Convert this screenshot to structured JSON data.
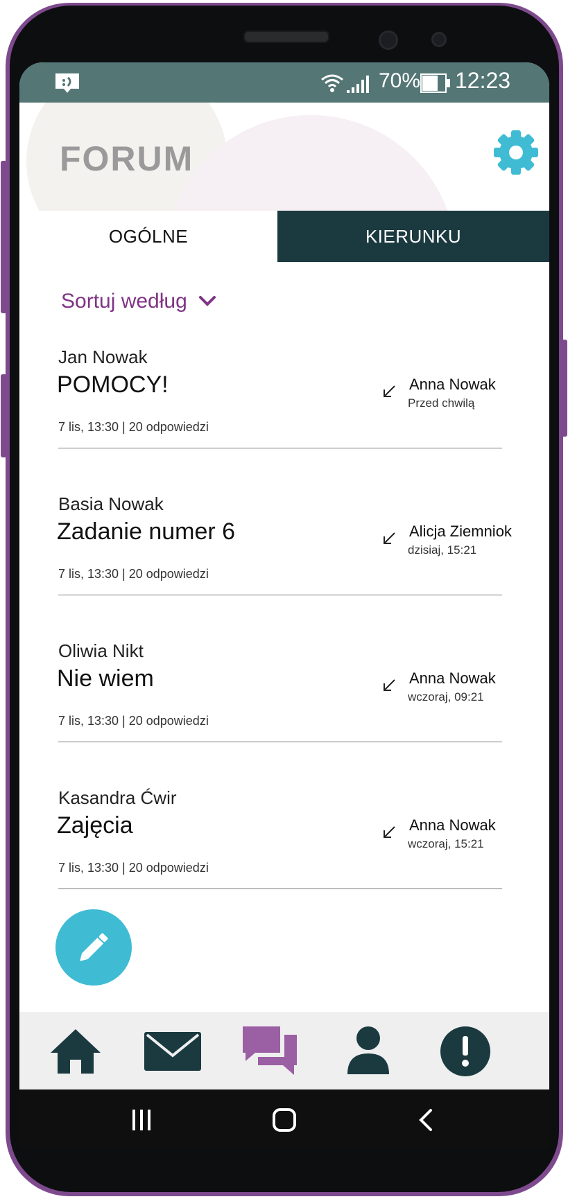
{
  "status_bar": {
    "battery_percent": "70%",
    "time": "12:23"
  },
  "header": {
    "title": "FORUM",
    "settings_icon": "gear-icon"
  },
  "tabs": [
    {
      "label": "OGÓLNE",
      "active": true
    },
    {
      "label": "KIERUNKU",
      "active": false
    }
  ],
  "sort": {
    "label": "Sortuj według",
    "icon": "chevron-down-icon"
  },
  "posts": [
    {
      "author": "Jan Nowak",
      "title": "POMOCY!",
      "meta": "7 lis, 13:30 | 20 odpowiedzi",
      "last_reply_name": "Anna Nowak",
      "last_reply_time": "Przed chwilą"
    },
    {
      "author": "Basia Nowak",
      "title": "Zadanie numer 6",
      "meta": "7 lis, 13:30 | 20 odpowiedzi",
      "last_reply_name": "Alicja Ziemniok",
      "last_reply_time": "dzisiaj, 15:21"
    },
    {
      "author": "Oliwia Nikt",
      "title": "Nie wiem",
      "meta": "7 lis, 13:30 | 20 odpowiedzi",
      "last_reply_name": "Anna Nowak",
      "last_reply_time": "wczoraj, 09:21"
    },
    {
      "author": "Kasandra Ćwir",
      "title": "Zajęcia",
      "meta": "7 lis, 13:30 | 20 odpowiedzi",
      "last_reply_name": "Anna Nowak",
      "last_reply_time": "wczoraj, 15:21"
    }
  ],
  "fab": {
    "icon": "pencil-icon"
  },
  "bottom_nav": [
    {
      "icon": "home-icon",
      "active": false
    },
    {
      "icon": "mail-icon",
      "active": false
    },
    {
      "icon": "forum-icon",
      "active": true
    },
    {
      "icon": "profile-icon",
      "active": false
    },
    {
      "icon": "alert-icon",
      "active": false
    }
  ],
  "colors": {
    "status_bar": "#547675",
    "tab_dark": "#1b3a40",
    "accent_purple": "#7f3485",
    "fab": "#3fbcd3",
    "nav_icon": "#1b3a40",
    "nav_active": "#9b5fa3"
  }
}
